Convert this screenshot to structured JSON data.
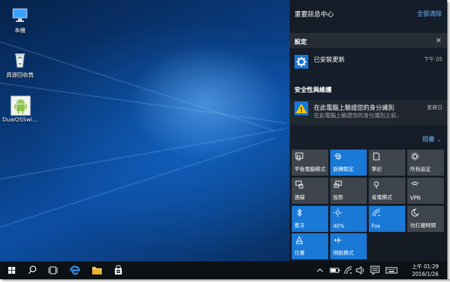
{
  "desktop": {
    "icons": [
      {
        "label": "本機",
        "icon": "computer-icon"
      },
      {
        "label": "資源回收筒",
        "icon": "recycle-bin-icon"
      },
      {
        "label": "DualOSSwi...",
        "icon": "android-icon"
      }
    ]
  },
  "action_center": {
    "title": "重要訊息中心",
    "clear_all": "全部清除",
    "groups": [
      {
        "name": "設定",
        "close_glyph": "×",
        "notification": {
          "icon": "gear-icon",
          "title": "已安裝更新",
          "time": "下午 05"
        }
      },
      {
        "name": "安全性與維護",
        "notification": {
          "icon": "warning-icon",
          "title": "在此電腦上驗證您的身分識別",
          "body": "在此電腦上驗證您的身分識別之前，",
          "time": "星期日"
        }
      }
    ],
    "collapse_label": "摺疊",
    "tiles": [
      {
        "label": "平板電腦模式",
        "icon": "tablet-mode-icon",
        "on": false
      },
      {
        "label": "旋轉鎖定",
        "icon": "rotation-lock-icon",
        "on": true
      },
      {
        "label": "筆記",
        "icon": "note-icon",
        "on": false
      },
      {
        "label": "所有設定",
        "icon": "settings-icon",
        "on": false
      },
      {
        "label": "連線",
        "icon": "connect-icon",
        "on": false
      },
      {
        "label": "投影",
        "icon": "project-icon",
        "on": false
      },
      {
        "label": "省電模式",
        "icon": "battery-saver-icon",
        "on": false
      },
      {
        "label": "VPN",
        "icon": "vpn-icon",
        "on": false
      },
      {
        "label": "藍牙",
        "icon": "bluetooth-icon",
        "on": true
      },
      {
        "label": "40%",
        "icon": "brightness-icon",
        "on": true
      },
      {
        "label": "Fox",
        "icon": "wifi-icon",
        "on": true
      },
      {
        "label": "勿打擾時間",
        "icon": "moon-icon",
        "on": false
      },
      {
        "label": "位置",
        "icon": "location-icon",
        "on": true
      },
      {
        "label": "飛航模式",
        "icon": "airplane-icon",
        "on": true
      }
    ]
  },
  "taskbar": {
    "buttons": [
      "windows-start-icon",
      "search-icon",
      "task-view-icon",
      "edge-icon",
      "file-explorer-icon",
      "store-icon"
    ],
    "tray_icons": [
      "chevron-up-icon",
      "battery-icon",
      "wifi-signal-icon",
      "volume-icon",
      "action-center-icon",
      "keyboard-icon"
    ],
    "time": "上午 01:29",
    "date": "2016/1/26"
  },
  "colors": {
    "accent": "#1a78d6",
    "link": "#6fb6ff",
    "panel": "#161a20",
    "taskbar": "#0d1116"
  }
}
